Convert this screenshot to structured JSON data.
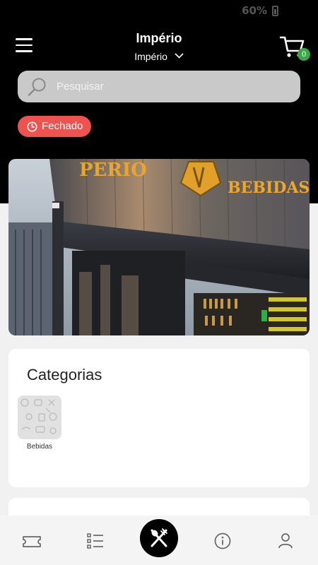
{
  "status_bar": {
    "battery": "60%"
  },
  "header": {
    "title": "Império",
    "store_selector": "Império",
    "cart_count": "0"
  },
  "search": {
    "placeholder": "Pesquisar"
  },
  "store_status": {
    "label": "Fechado",
    "color": "#ef5350"
  },
  "banner": {
    "sign_left": "PERIO",
    "sign_right": "BEBIDAS"
  },
  "categories": {
    "title": "Categorias",
    "items": [
      {
        "label": "Bebidas"
      }
    ]
  },
  "bottom_nav": {
    "items": [
      {
        "icon": "ticket-icon"
      },
      {
        "icon": "list-icon"
      },
      {
        "icon": "cutlery-icon"
      },
      {
        "icon": "info-icon"
      },
      {
        "icon": "user-icon"
      }
    ]
  },
  "colors": {
    "accent_green": "#3aa847",
    "header_bg": "#000000"
  }
}
